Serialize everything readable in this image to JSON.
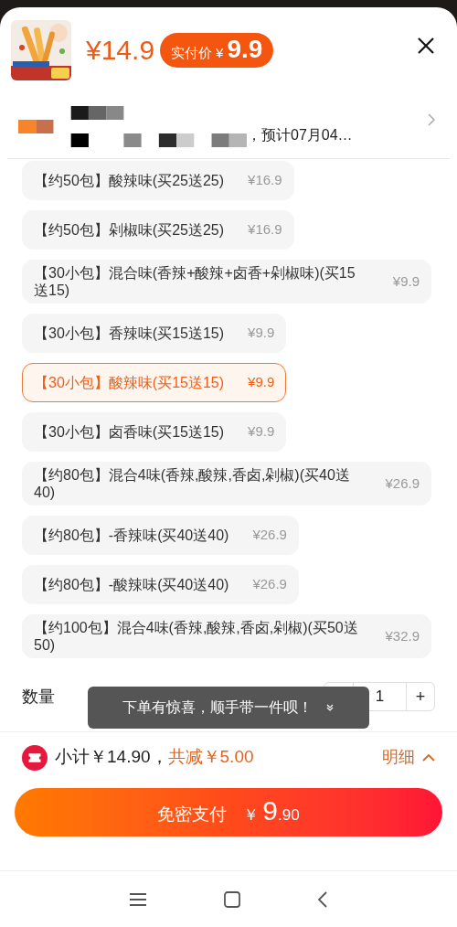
{
  "header": {
    "original_price": "¥14.9",
    "badge_label": "实付价",
    "badge_currency": "¥",
    "badge_price": "9.9"
  },
  "address": {
    "delivery": "，预计07月04…"
  },
  "options": [
    {
      "label": "【约50包】酸辣味(买25送25)",
      "price": "¥16.9",
      "selected": false
    },
    {
      "label": "【约50包】剁椒味(买25送25)",
      "price": "¥16.9",
      "selected": false
    },
    {
      "label": "【30小包】混合味(香辣+酸辣+卤香+剁椒味)(买15送15)",
      "price": "¥9.9",
      "selected": false
    },
    {
      "label": "【30小包】香辣味(买15送15)",
      "price": "¥9.9",
      "selected": false
    },
    {
      "label": "【30小包】酸辣味(买15送15)",
      "price": "¥9.9",
      "selected": true
    },
    {
      "label": "【30小包】卤香味(买15送15)",
      "price": "¥9.9",
      "selected": false
    },
    {
      "label": "【约80包】混合4味(香辣,酸辣,香卤,剁椒)(买40送40)",
      "price": "¥26.9",
      "selected": false
    },
    {
      "label": "【约80包】-香辣味(买40送40)",
      "price": "¥26.9",
      "selected": false
    },
    {
      "label": "【约80包】-酸辣味(买40送40)",
      "price": "¥26.9",
      "selected": false
    },
    {
      "label": "【约100包】混合4味(香辣,酸辣,香卤,剁椒)(买50送50)",
      "price": "¥32.9",
      "selected": false
    }
  ],
  "quantity": {
    "label": "数量",
    "value": "1",
    "plus": "+"
  },
  "toast": "下单有惊喜，顺手带一件呗！",
  "summary": {
    "subtotal": "小计￥14.90，",
    "discount": "共减￥5.00",
    "details": "明细"
  },
  "pay_button": {
    "label": "免密支付",
    "currency": "￥",
    "integer": "9",
    "decimals": ".90"
  }
}
